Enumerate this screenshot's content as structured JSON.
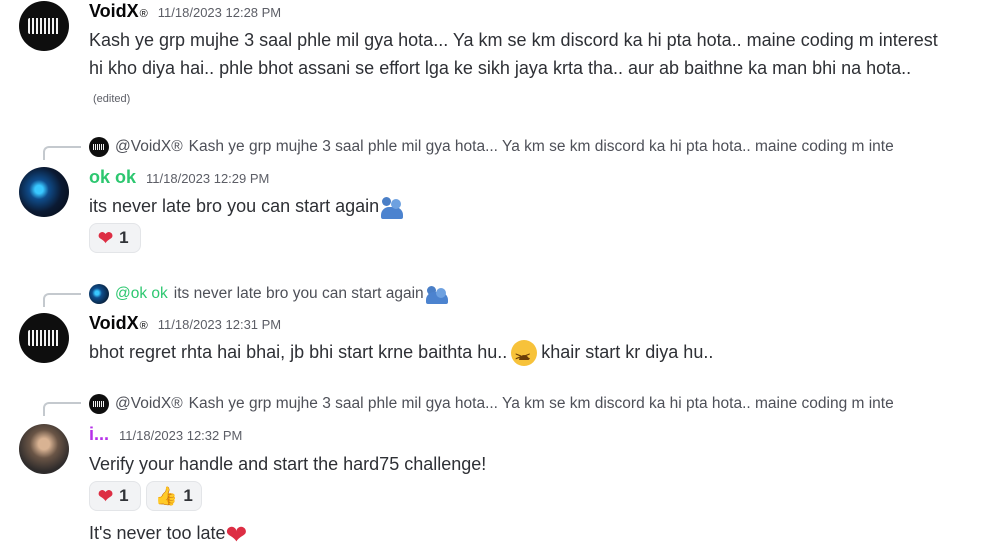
{
  "messages": {
    "m1": {
      "username": "VoidX",
      "badge": "®",
      "timestamp": "11/18/2023 12:28 PM",
      "text": "Kash ye grp mujhe 3 saal phle mil gya hota... Ya km se km discord ka hi pta hota.. maine coding m interest hi kho diya hai.. phle bhot assani se effort lga ke sikh jaya krta tha.. aur ab baithne ka man bhi na hota..",
      "edited": "(edited)"
    },
    "m2": {
      "reply_name": "@VoidX®",
      "reply_text": "Kash ye grp mujhe 3 saal phle mil gya hota... Ya km se km discord ka hi pta hota.. maine coding m inte",
      "username": "ok ok",
      "timestamp": "11/18/2023 12:29 PM",
      "text": "its never late bro you can start again",
      "reactions": [
        {
          "emoji": "heart-emoji",
          "count": "1"
        }
      ]
    },
    "m3": {
      "reply_name": "@ok ok",
      "reply_text": "its never late bro you can start again",
      "username": "VoidX",
      "badge": "®",
      "timestamp": "11/18/2023 12:31 PM",
      "text_before": "bhot regret rhta hai bhai, jb bhi start krne baithta hu..",
      "text_after": "khair start kr diya hu.."
    },
    "m4": {
      "reply_name": "@VoidX®",
      "reply_text": "Kash ye grp mujhe 3 saal phle mil gya hota... Ya km se km discord ka hi pta hota.. maine coding m inte",
      "username": "i...",
      "timestamp": "11/18/2023 12:32 PM",
      "text": "Verify your handle and start the hard75 challenge!",
      "reactions": [
        {
          "emoji": "heart-emoji",
          "count": "1"
        },
        {
          "emoji": "thumbs-up-emoji",
          "count": "1"
        }
      ]
    },
    "m5": {
      "text": "It's never too late"
    }
  },
  "colors": {
    "green_name": "#2dc770",
    "purple_name": "#b530e8",
    "heart": "#dd2e44"
  }
}
